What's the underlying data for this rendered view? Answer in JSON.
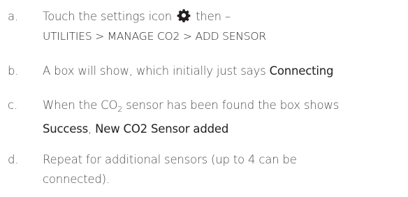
{
  "steps": [
    {
      "marker": "a.",
      "text_before_icon": "Touch the settings icon",
      "icon": "gear-icon",
      "text_after_icon": "then –",
      "menu_path": "UTILITIES > MANAGE CO2 > ADD SENSOR"
    },
    {
      "marker": "b.",
      "text": "A box will show, which initially just says",
      "bold": "Connecting"
    },
    {
      "marker": "c.",
      "text_before_sub": "When the CO",
      "subscript": "2",
      "text_after_sub": "sensor has been found the box shows",
      "bold_1": "Success",
      "separator": ",",
      "bold_2": "New CO2 Sensor added"
    },
    {
      "marker": "d.",
      "line_1": "Repeat for additional sensors (up to 4 can be",
      "line_2": "connected)."
    }
  ],
  "colors": {
    "body_text": "#4d4d4f",
    "emphasis_text": "#231f20"
  }
}
